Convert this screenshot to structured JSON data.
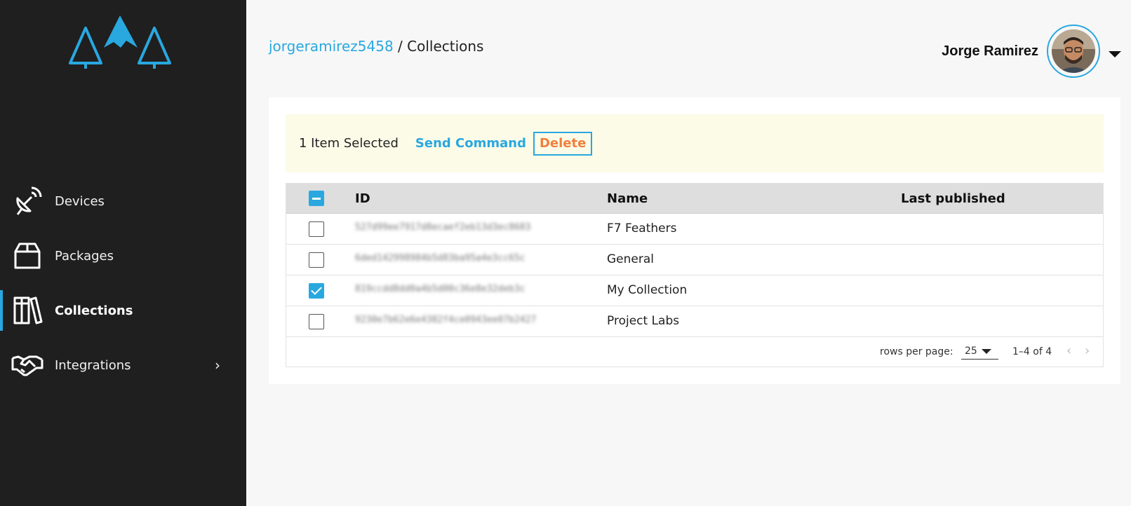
{
  "sidebar": {
    "items": [
      {
        "label": "Devices",
        "icon": "satellite-dish-icon"
      },
      {
        "label": "Packages",
        "icon": "package-box-icon"
      },
      {
        "label": "Collections",
        "icon": "books-icon",
        "active": true
      },
      {
        "label": "Integrations",
        "icon": "handshake-icon",
        "has_submenu": true
      }
    ]
  },
  "header": {
    "breadcrumb_user": "jorgeramirez5458",
    "breadcrumb_separator": " / ",
    "breadcrumb_page": "Collections",
    "user_name": "Jorge Ramirez"
  },
  "selection": {
    "count_text": "1 Item Selected",
    "send_command_label": "Send Command",
    "delete_label": "Delete"
  },
  "table": {
    "columns": [
      "ID",
      "Name",
      "Last published"
    ],
    "rows": [
      {
        "id": "527d99ee7917d8ecaef2eb13d3ec8683",
        "name": "F7 Feathers",
        "last_published": "",
        "checked": false
      },
      {
        "id": "6ded142998984b5d83ba95a4e3cc65c",
        "name": "General",
        "last_published": "",
        "checked": false
      },
      {
        "id": "819ccdd8dd0a4b5d00c36e8e32deb3c",
        "name": "My Collection",
        "last_published": "",
        "checked": true
      },
      {
        "id": "9230e7b62e6e4382f4ce0943ee07b2427",
        "name": "Project Labs",
        "last_published": "",
        "checked": false
      }
    ]
  },
  "pagination": {
    "rows_per_page_label": "rows per page:",
    "rows_per_page_value": "25",
    "range_text": "1–4 of 4",
    "prev_glyph": "‹",
    "next_glyph": "›"
  },
  "colors": {
    "accent": "#29a8e0",
    "delete": "#f07f3c",
    "sidebar_bg": "#1f1f1f",
    "selection_bg": "#fcfbe8"
  }
}
